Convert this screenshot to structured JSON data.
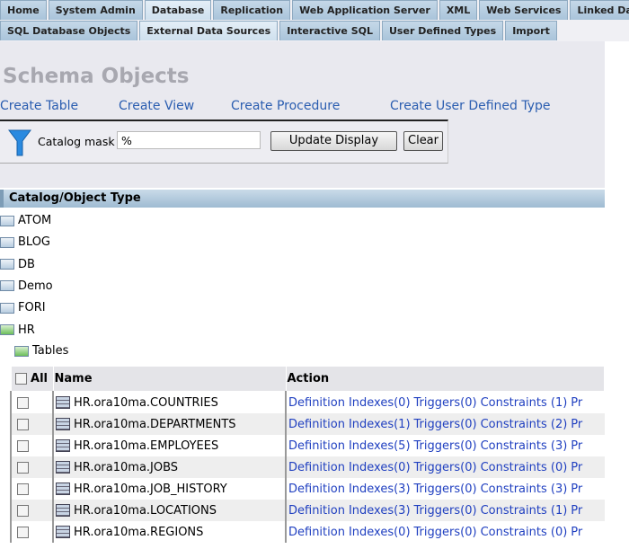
{
  "tabs_main": [
    {
      "label": "Home"
    },
    {
      "label": "System Admin"
    },
    {
      "label": "Database",
      "active": true
    },
    {
      "label": "Replication"
    },
    {
      "label": "Web Application Server"
    },
    {
      "label": "XML"
    },
    {
      "label": "Web Services"
    },
    {
      "label": "Linked Data"
    }
  ],
  "tabs_sub": [
    {
      "label": "SQL Database Objects"
    },
    {
      "label": "External Data Sources",
      "active": true
    },
    {
      "label": "Interactive SQL"
    },
    {
      "label": "User Defined Types"
    },
    {
      "label": "Import"
    }
  ],
  "page_title": "Schema Objects",
  "links": {
    "create_table": "Create Table",
    "create_view": "Create View",
    "create_procedure": "Create Procedure",
    "create_udt": "Create User Defined Type"
  },
  "filter": {
    "label": "Catalog mask",
    "value": "%",
    "update": "Update Display",
    "clear": "Clear"
  },
  "tree_header": "Catalog/Object Type",
  "catalogs": [
    "ATOM",
    "BLOG",
    "DB",
    "Demo",
    "FORI",
    "HR"
  ],
  "tables_node": "Tables",
  "table": {
    "col_all": "All",
    "col_name": "Name",
    "col_action": "Action",
    "rows": [
      {
        "name": "HR.ora10ma.COUNTRIES",
        "indexes": "Indexes(0)",
        "triggers": "Triggers(0)",
        "constraints": "Constraints (1)"
      },
      {
        "name": "HR.ora10ma.DEPARTMENTS",
        "indexes": "Indexes(1)",
        "triggers": "Triggers(0)",
        "constraints": "Constraints (2)"
      },
      {
        "name": "HR.ora10ma.EMPLOYEES",
        "indexes": "Indexes(5)",
        "triggers": "Triggers(0)",
        "constraints": "Constraints (3)"
      },
      {
        "name": "HR.ora10ma.JOBS",
        "indexes": "Indexes(0)",
        "triggers": "Triggers(0)",
        "constraints": "Constraints (0)"
      },
      {
        "name": "HR.ora10ma.JOB_HISTORY",
        "indexes": "Indexes(3)",
        "triggers": "Triggers(0)",
        "constraints": "Constraints (3)"
      },
      {
        "name": "HR.ora10ma.LOCATIONS",
        "indexes": "Indexes(3)",
        "triggers": "Triggers(0)",
        "constraints": "Constraints (1)"
      },
      {
        "name": "HR.ora10ma.REGIONS",
        "indexes": "Indexes(0)",
        "triggers": "Triggers(0)",
        "constraints": "Constraints (0)"
      }
    ],
    "definition": "Definition",
    "truncated": "Pr"
  }
}
